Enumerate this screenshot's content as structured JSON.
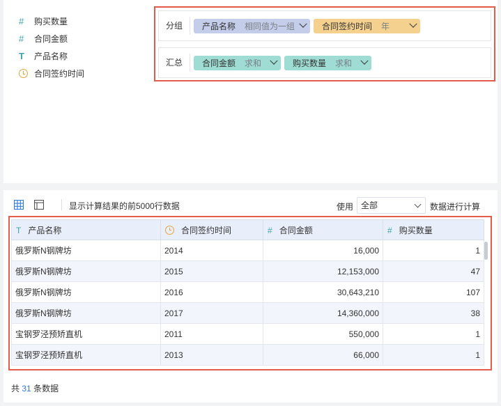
{
  "fields": [
    {
      "icon": "hash-icon",
      "label": "购买数量"
    },
    {
      "icon": "hash-icon",
      "label": "合同金额"
    },
    {
      "icon": "text-type-icon",
      "label": "产品名称"
    },
    {
      "icon": "clock-icon",
      "label": "合同签约时间"
    }
  ],
  "config": {
    "group_label": "分组",
    "sum_label": "汇总",
    "group_chips": [
      {
        "name": "产品名称",
        "sub": "相同值为一组"
      },
      {
        "name": "合同签约时间",
        "sub": "年"
      }
    ],
    "sum_chips": [
      {
        "name": "合同金额",
        "sub": "求和"
      },
      {
        "name": "购买数量",
        "sub": "求和"
      }
    ]
  },
  "toolbar": {
    "info": "显示计算结果的前5000行数据",
    "use_label": "使用",
    "select_value": "全部",
    "after_label": "数据进行计算"
  },
  "table": {
    "headers": [
      "产品名称",
      "合同签约时间",
      "合同金额",
      "购买数量"
    ],
    "rows": [
      [
        "俄罗斯N钢牌坊",
        "2014",
        "16,000",
        "1"
      ],
      [
        "俄罗斯N钢牌坊",
        "2015",
        "12,153,000",
        "47"
      ],
      [
        "俄罗斯N钢牌坊",
        "2016",
        "30,643,210",
        "107"
      ],
      [
        "俄罗斯N钢牌坊",
        "2017",
        "14,360,000",
        "38"
      ],
      [
        "宝钢罗泾预矫直机",
        "2011",
        "550,000",
        "1"
      ],
      [
        "宝钢罗泾预矫直机",
        "2013",
        "66,000",
        "1"
      ]
    ]
  },
  "footer": {
    "prefix": "共",
    "count": "31",
    "suffix": "条数据"
  },
  "colors": {
    "highlight_border": "#e35c4a",
    "chip_blue": "#c4cde9",
    "chip_orange": "#f5d18f",
    "chip_teal": "#9fdcd3",
    "count_blue": "#2f7bd8"
  }
}
